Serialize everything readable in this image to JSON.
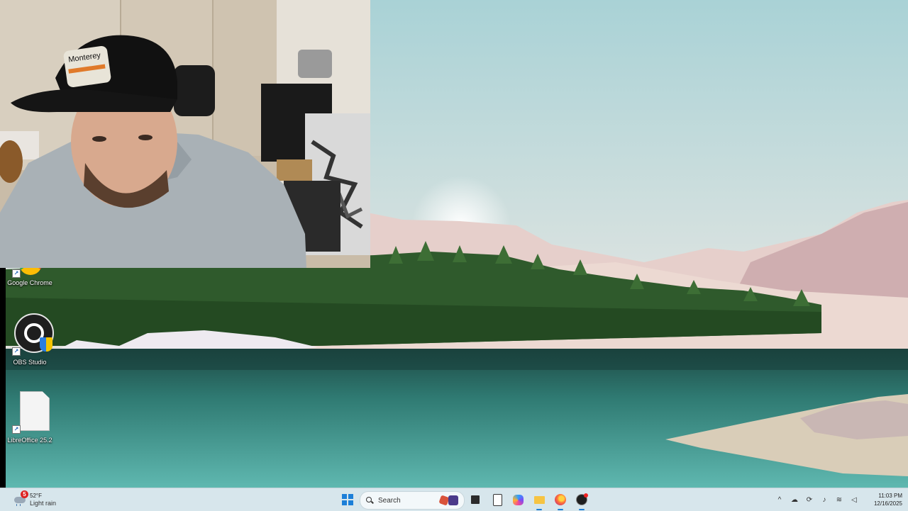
{
  "desktop": {
    "icons": [
      {
        "label": "Google Chrome",
        "icon": "chrome-icon"
      },
      {
        "label": "OBS Studio",
        "icon": "obs-icon"
      },
      {
        "label": "LibreOffice 25.2",
        "icon": "libreoffice-icon"
      }
    ]
  },
  "webcam": {
    "cap_text": "Monterey"
  },
  "taskbar": {
    "weather": {
      "badge": "5",
      "temperature": "52°F",
      "condition": "Light rain"
    },
    "search": {
      "label": "Search"
    },
    "apps": [
      "start-icon",
      "search-icon",
      "task-view-icon",
      "file-icon",
      "copilot-icon",
      "file-explorer-icon",
      "firefox-icon",
      "obs-icon"
    ],
    "tray_icons": [
      "chevron-up-icon",
      "onedrive-icon",
      "sync-icon",
      "microphone-icon",
      "wifi-icon",
      "volume-icon"
    ],
    "clock": {
      "time": "11:03 PM",
      "date": "12/16/2025"
    }
  }
}
